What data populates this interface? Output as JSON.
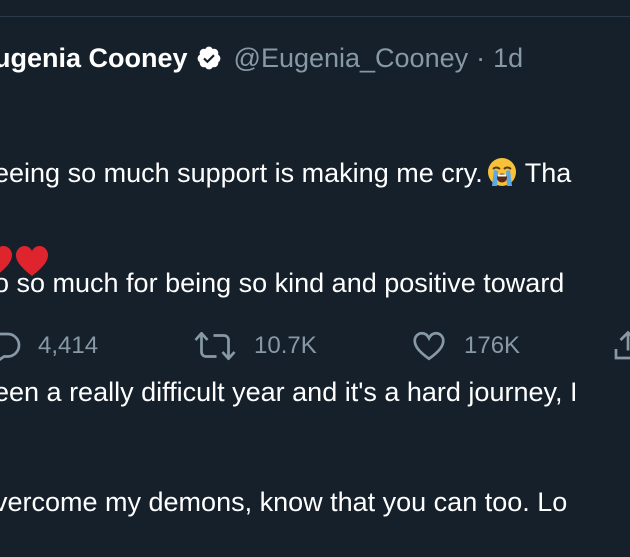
{
  "tweet": {
    "display_name": "ugenia Cooney",
    "handle": "@Eugenia_Cooney",
    "separator": "·",
    "time": "1d",
    "text_line1_a": "eeing so much support is making me cry.",
    "text_line1_b": "Tha",
    "text_line2": "o so much for being so kind and positive toward",
    "text_line3": "een a really difficult year and it's a hard journey, I",
    "text_line4": "vercome my demons, know that you can too. Lo"
  },
  "actions": {
    "reply_count": "4,414",
    "retweet_count": "10.7K",
    "like_count": "176K"
  },
  "icons": {
    "verified": "verified-badge-icon",
    "emoji": "loudly-crying-face-icon",
    "hearts": "red-heart-icon",
    "reply": "reply-icon",
    "retweet": "retweet-icon",
    "like": "like-heart-icon",
    "share": "share-icon"
  },
  "colors": {
    "background": "#15202b",
    "muted": "#8899a6",
    "heart_red": "#e0242e"
  }
}
